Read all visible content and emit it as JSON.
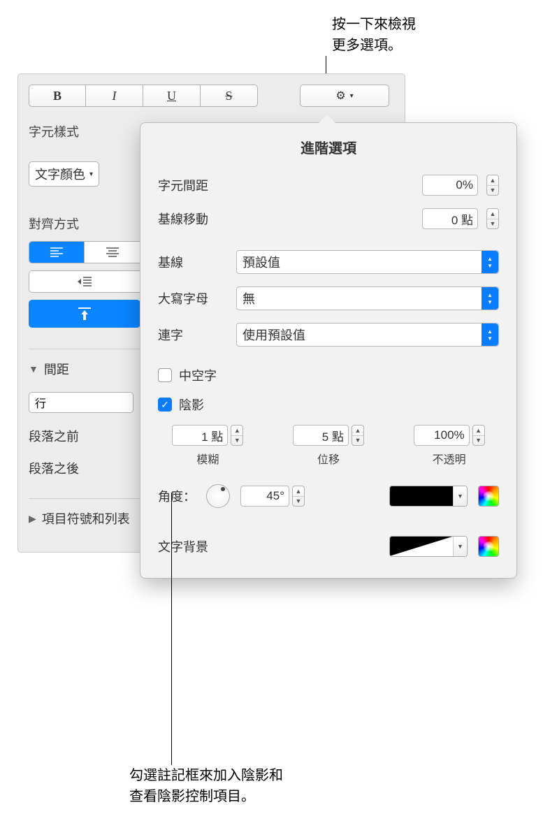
{
  "callouts": {
    "top": "按一下來檢視\n更多選項。",
    "bottom": "勾選註記框來加入陰影和\n查看陰影控制項目。"
  },
  "sidebar": {
    "char_style_label": "字元樣式",
    "text_color_label": "文字顏色",
    "alignment_label": "對齊方式",
    "spacing": {
      "label": "間距",
      "line_label": "行",
      "before_para": "段落之前",
      "after_para": "段落之後"
    },
    "bullets_label": "項目符號和列表"
  },
  "popover": {
    "title": "進階選項",
    "char_spacing_label": "字元間距",
    "char_spacing_value": "0%",
    "baseline_shift_label": "基線移動",
    "baseline_shift_value": "0 點",
    "baseline_label": "基線",
    "baseline_select": "預設值",
    "capitalization_label": "大寫字母",
    "capitalization_select": "無",
    "ligatures_label": "連字",
    "ligatures_select": "使用預設值",
    "outline_label": "中空字",
    "shadow_label": "陰影",
    "shadow": {
      "blur_value": "1 點",
      "blur_label": "模糊",
      "offset_value": "5 點",
      "offset_label": "位移",
      "opacity_value": "100%",
      "opacity_label": "不透明",
      "angle_label": "角度：",
      "angle_value": "45°",
      "shadow_color": "#000000"
    },
    "text_bg_label": "文字背景"
  }
}
